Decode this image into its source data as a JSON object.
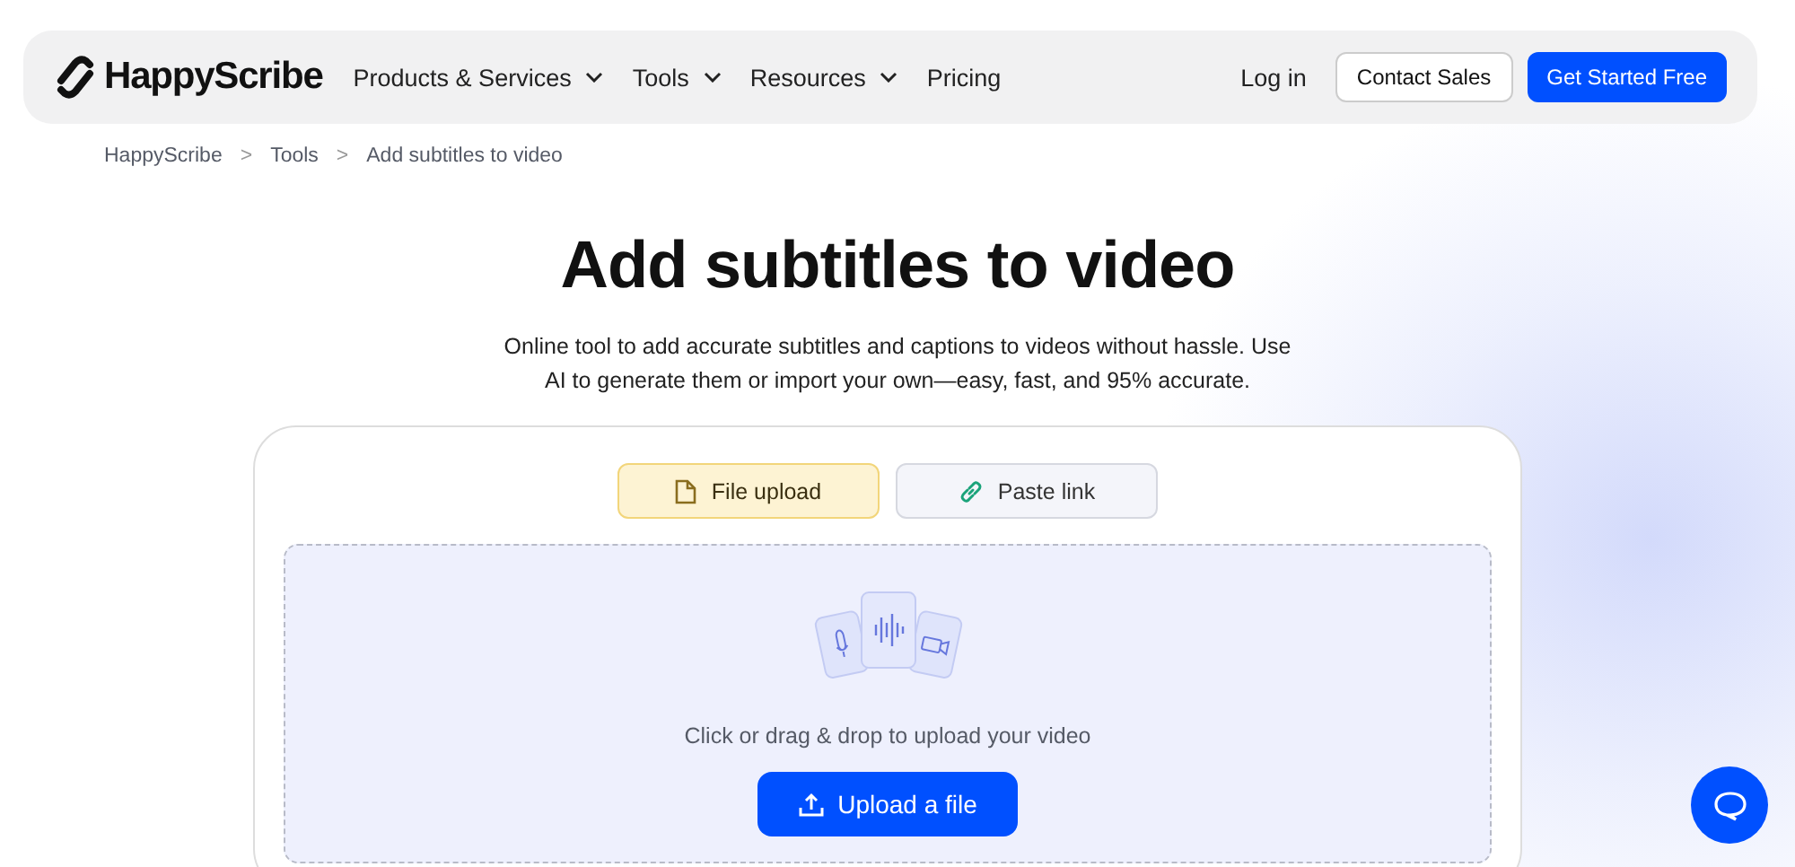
{
  "logo": {
    "text": "HappyScribe"
  },
  "nav": [
    {
      "label": "Products & Services",
      "dropdown": true
    },
    {
      "label": "Tools",
      "dropdown": true
    },
    {
      "label": "Resources",
      "dropdown": true
    },
    {
      "label": "Pricing",
      "dropdown": false
    }
  ],
  "login": "Log in",
  "contact_button": "Contact Sales",
  "cta_button": "Get Started Free",
  "breadcrumb": [
    {
      "label": "HappyScribe"
    },
    {
      "label": "Tools"
    },
    {
      "label": "Add subtitles to video"
    }
  ],
  "breadcrumb_separator": ">",
  "title": "Add subtitles to video",
  "description": "Online tool to add accurate subtitles and captions to videos without hassle. Use AI to generate them or import your own—easy, fast, and 95% accurate.",
  "tabs": [
    {
      "label": "File upload",
      "kind": "file",
      "selected": true
    },
    {
      "label": "Paste link",
      "kind": "link",
      "selected": false
    }
  ],
  "dropzone": {
    "hint": "Click or drag & drop to upload your video",
    "button": "Upload a file"
  }
}
